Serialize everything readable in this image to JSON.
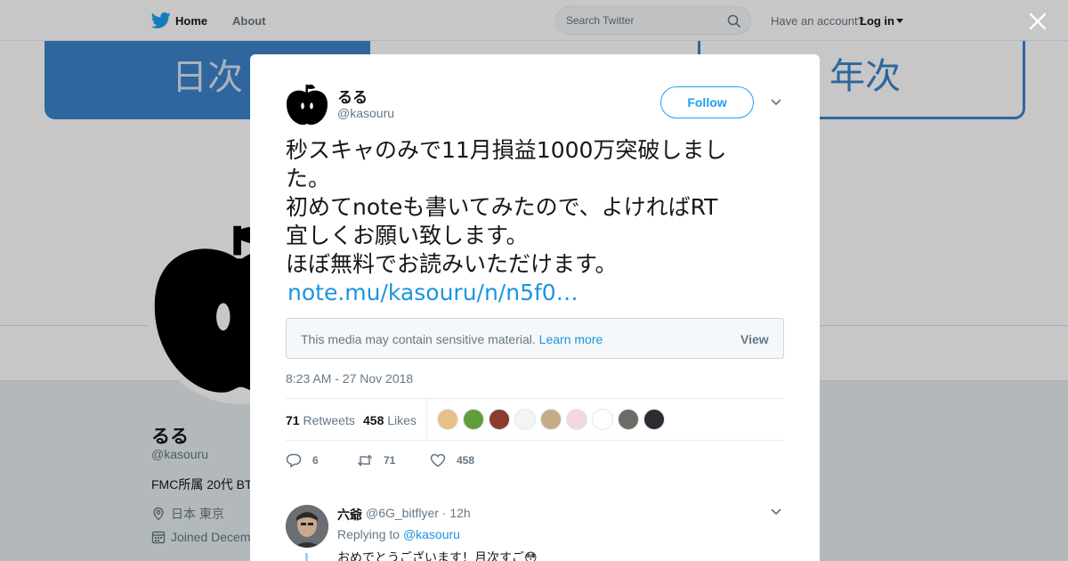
{
  "nav": {
    "home": "Home",
    "about": "About",
    "search_placeholder": "Search Twitter",
    "account_prompt": "Have an account?",
    "login": "Log in"
  },
  "banner": {
    "daily": "日次",
    "yearly": "年次"
  },
  "profile": {
    "name": "るる",
    "handle": "@kasouru",
    "bio": "FMC所属 20代 BT",
    "location": "日本 東京",
    "joined": "Joined Decem"
  },
  "tweet": {
    "author_name": "るる",
    "author_handle": "@kasouru",
    "follow_label": "Follow",
    "lines": [
      "秒スキャのみで11月損益1000万突破しまし",
      "た。",
      "初めてnoteも書いてみたので、よければRT",
      "宜しくお願い致します。",
      "ほぼ無料でお読みいただけます。"
    ],
    "link": "note.mu/kasouru/n/n5f0…",
    "sensitive_msg": "This media may contain sensitive material.",
    "learn_more": "Learn more",
    "view_label": "View",
    "timestamp": "8:23 AM - 27 Nov 2018",
    "retweets": "71",
    "retweets_label": "Retweets",
    "likes": "458",
    "likes_label": "Likes",
    "reply_count": "6",
    "retweet_count": "71",
    "like_count": "458"
  },
  "reply": {
    "name": "六爺",
    "handle": "@6G_bitflyer · 12h",
    "replying_prefix": "Replying to",
    "replying_to": "@kasouru",
    "text": "おめでとうございます！月次すご😳"
  },
  "colors": {
    "accent": "#1da1f2",
    "link": "#1b95e0",
    "banner_blue": "#3c83c9",
    "text": "#14171a",
    "muted": "#657786"
  },
  "likers": [
    {
      "color": "#e8c08a"
    },
    {
      "color": "#5f9e3a"
    },
    {
      "color": "#8a3d2b"
    },
    {
      "color": "#f4f4f4"
    },
    {
      "color": "#c6ab86"
    },
    {
      "color": "#f3d7e0"
    },
    {
      "color": "#ffffff"
    },
    {
      "color": "#6e6a66"
    },
    {
      "color": "#2b2d33"
    }
  ]
}
